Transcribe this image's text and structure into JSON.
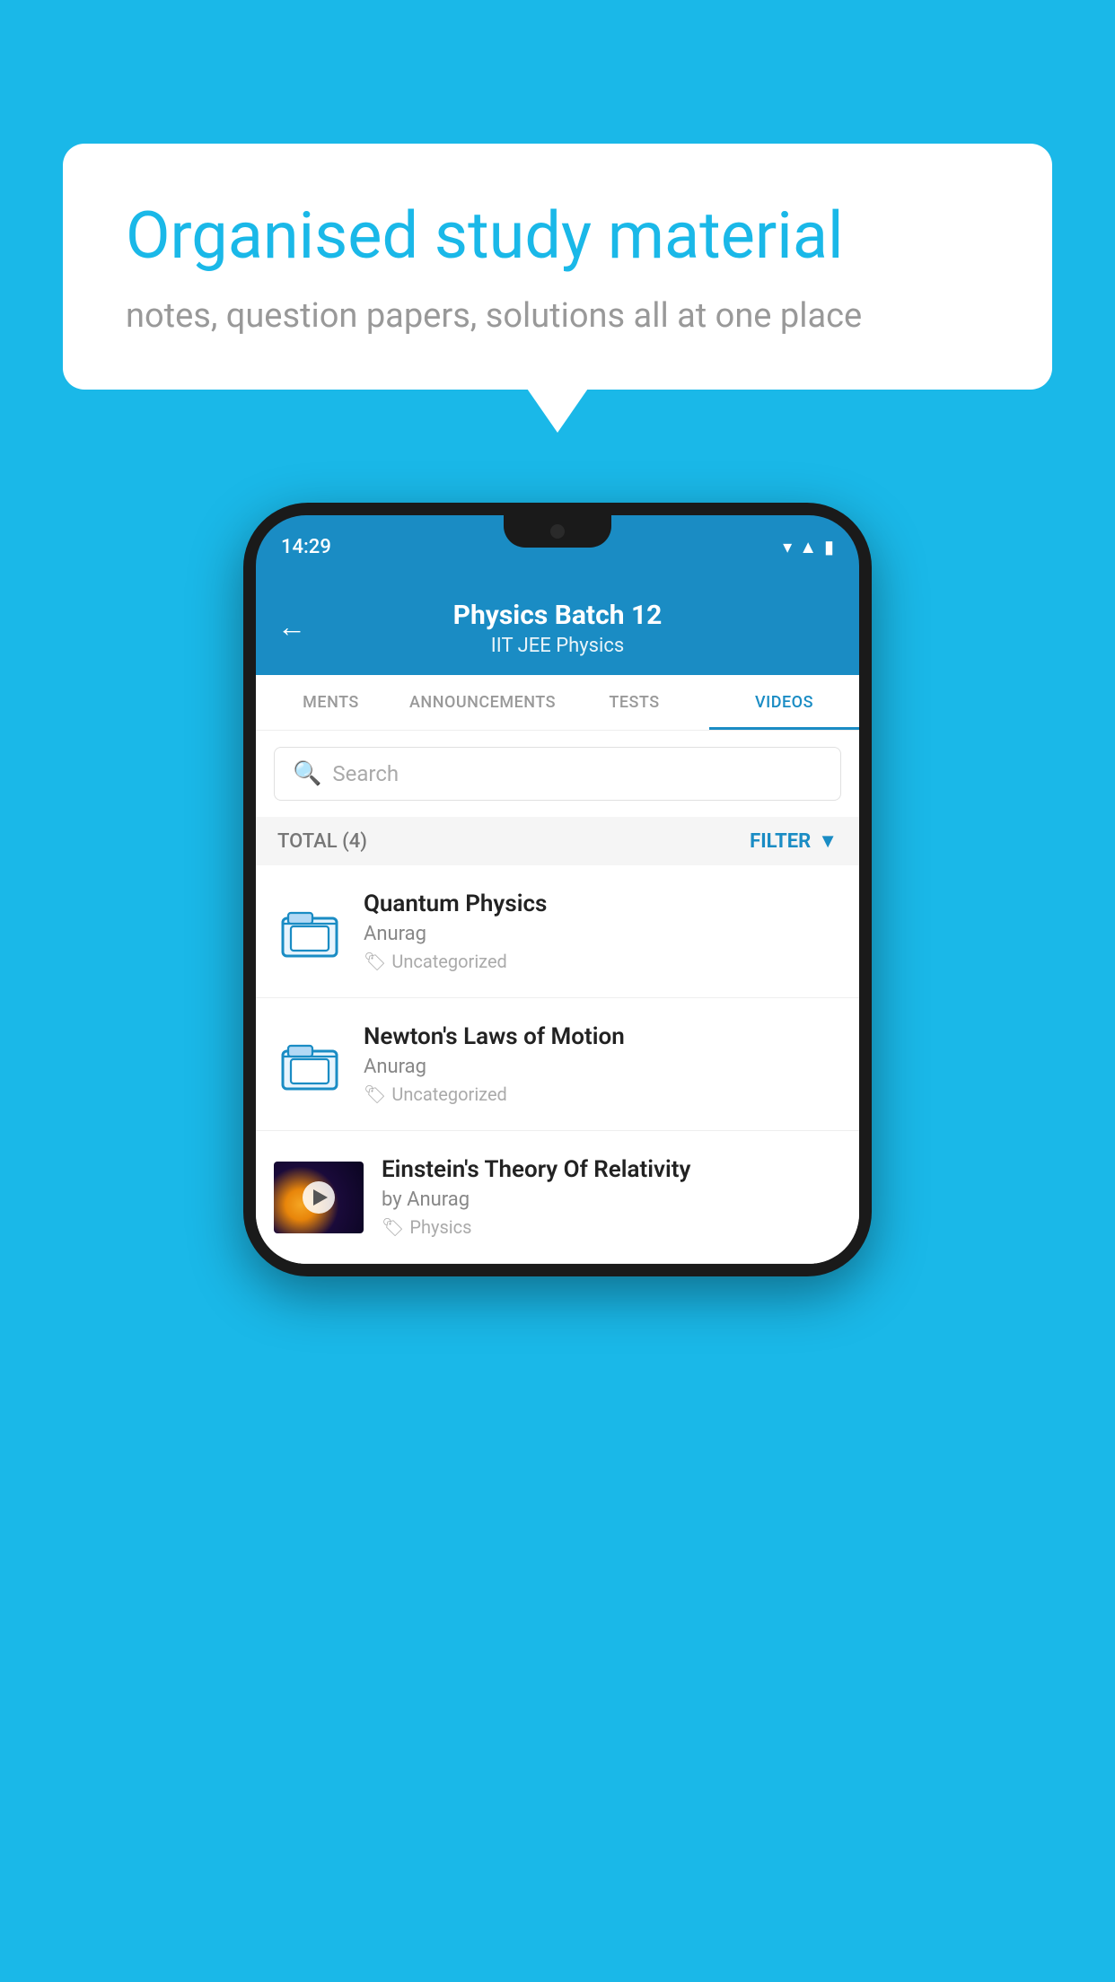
{
  "background_color": "#1ab8e8",
  "speech_bubble": {
    "title": "Organised study material",
    "subtitle": "notes, question papers, solutions all at one place"
  },
  "phone": {
    "status_bar": {
      "time": "14:29"
    },
    "header": {
      "back_label": "←",
      "title": "Physics Batch 12",
      "subtitle": "IIT JEE    Physics"
    },
    "tabs": [
      {
        "label": "MENTS",
        "active": false
      },
      {
        "label": "ANNOUNCEMENTS",
        "active": false
      },
      {
        "label": "TESTS",
        "active": false
      },
      {
        "label": "VIDEOS",
        "active": true
      }
    ],
    "search": {
      "placeholder": "Search"
    },
    "filter_bar": {
      "total_label": "TOTAL (4)",
      "filter_label": "FILTER"
    },
    "videos": [
      {
        "id": "1",
        "title": "Quantum Physics",
        "author": "Anurag",
        "tag": "Uncategorized",
        "has_thumbnail": false
      },
      {
        "id": "2",
        "title": "Newton's Laws of Motion",
        "author": "Anurag",
        "tag": "Uncategorized",
        "has_thumbnail": false
      },
      {
        "id": "3",
        "title": "Einstein's Theory Of Relativity",
        "author": "by Anurag",
        "tag": "Physics",
        "has_thumbnail": true
      }
    ]
  }
}
